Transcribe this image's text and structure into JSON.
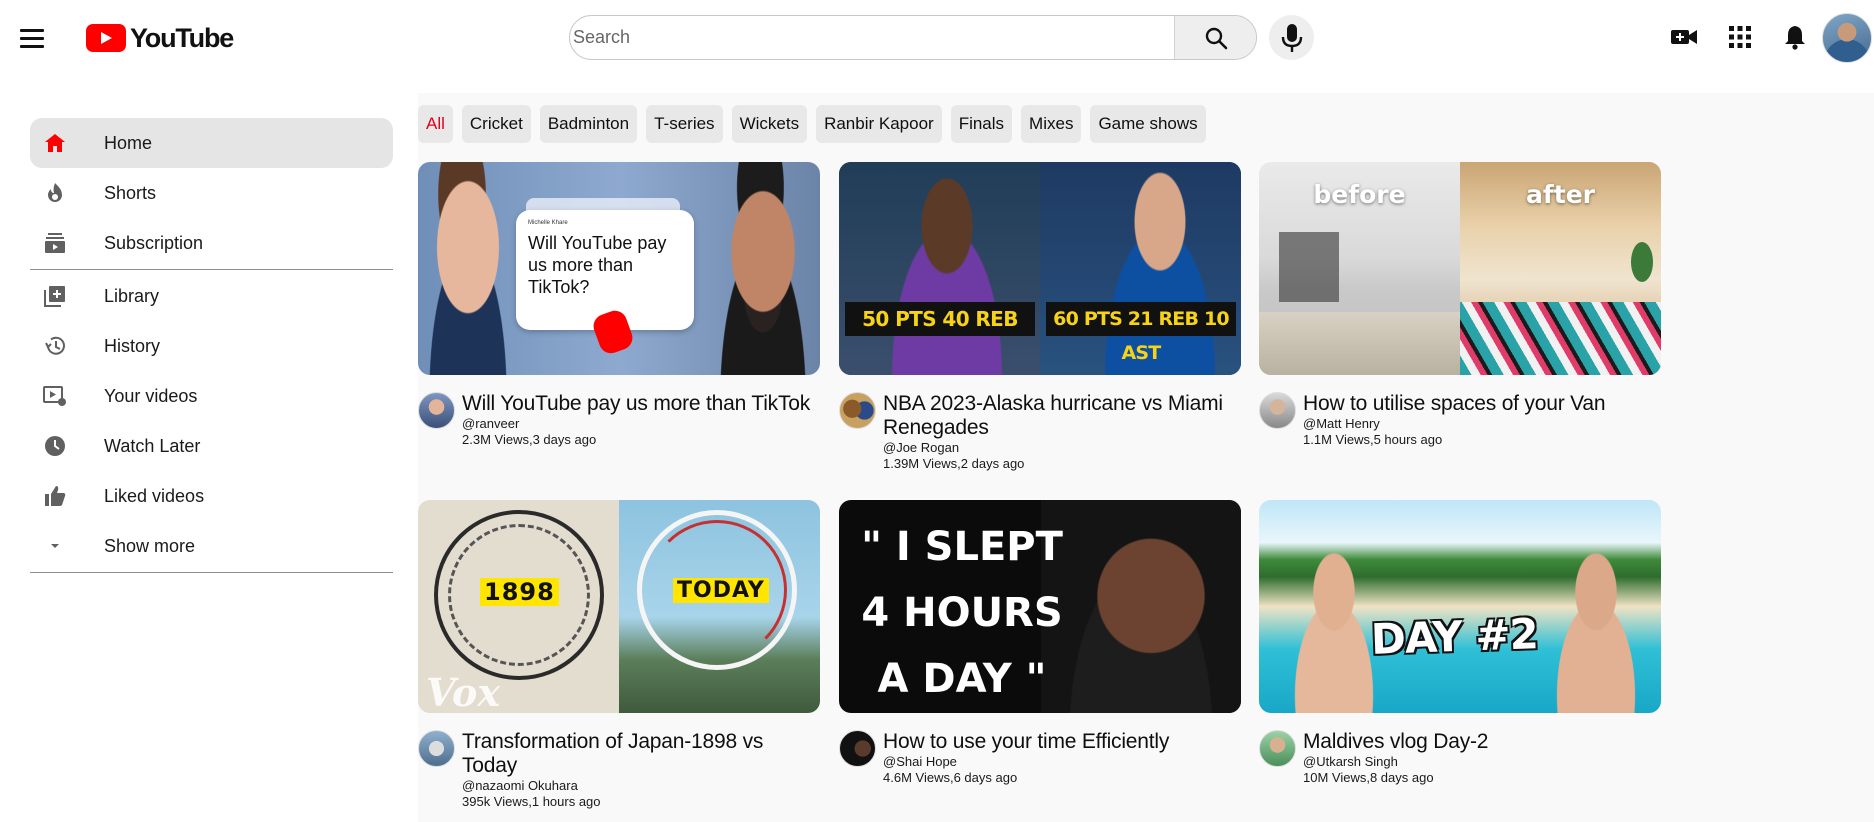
{
  "header": {
    "logo_text": "YouTube",
    "search_placeholder": "Search"
  },
  "sidebar": {
    "items": [
      {
        "label": "Home",
        "icon": "home-icon",
        "active": true
      },
      {
        "label": "Shorts",
        "icon": "shorts-icon"
      },
      {
        "label": "Subscription",
        "icon": "subscriptions-icon"
      },
      {
        "label": "Library",
        "icon": "library-icon"
      },
      {
        "label": "History",
        "icon": "history-icon"
      },
      {
        "label": "Your videos",
        "icon": "your-videos-icon"
      },
      {
        "label": "Watch Later",
        "icon": "watch-later-icon"
      },
      {
        "label": "Liked videos",
        "icon": "like-icon"
      },
      {
        "label": "Show more",
        "icon": "chevron-down-icon"
      }
    ]
  },
  "chips": [
    "All",
    "Cricket",
    "Badminton",
    "T-series",
    "Wickets",
    "Ranbir Kapoor",
    "Finals",
    "Mixes",
    "Game shows"
  ],
  "videos": [
    {
      "title": "Will YouTube pay us more than TikTok",
      "channel": "@ranveer",
      "stats": "2.3M Views,3 days ago",
      "thumb_text": "Will YouTube pay us more than TikTok?",
      "thumb_caption": "Michelle Khare"
    },
    {
      "title": "NBA 2023-Alaska hurricane vs Miami Renegades",
      "channel": "@Joe Rogan",
      "stats": "1.39M Views,2 days ago",
      "thumb_left": "50 PTS  40 REB",
      "thumb_right": "60 PTS  21 REB  10 AST"
    },
    {
      "title": "How to utilise spaces of your Van",
      "channel": "@Matt Henry",
      "stats": "1.1M Views,5 hours ago",
      "thumb_left": "before",
      "thumb_right": "after"
    },
    {
      "title": "Transformation of Japan-1898 vs Today",
      "channel": "@nazaomi Okuhara",
      "stats": "395k Views,1 hours ago",
      "thumb_left": "1898",
      "thumb_right": "TODAY",
      "thumb_watermark": "Vox"
    },
    {
      "title": "How to use your time Efficiently",
      "channel": "@Shai Hope",
      "stats": "4.6M Views,6 days ago",
      "thumb_lines": [
        "\" I SLEPT",
        "4 HOURS",
        "A DAY \""
      ]
    },
    {
      "title": "Maldives vlog Day-2",
      "channel": "@Utkarsh Singh",
      "stats": "10M Views,8 days ago",
      "thumb_text": "DAY #2"
    }
  ],
  "colors": {
    "brand_red": "#ff0000",
    "active_chip_text": "#e2001a",
    "sidebar_active_bg": "#e5e5e5",
    "main_bg": "#f9f9f9"
  }
}
